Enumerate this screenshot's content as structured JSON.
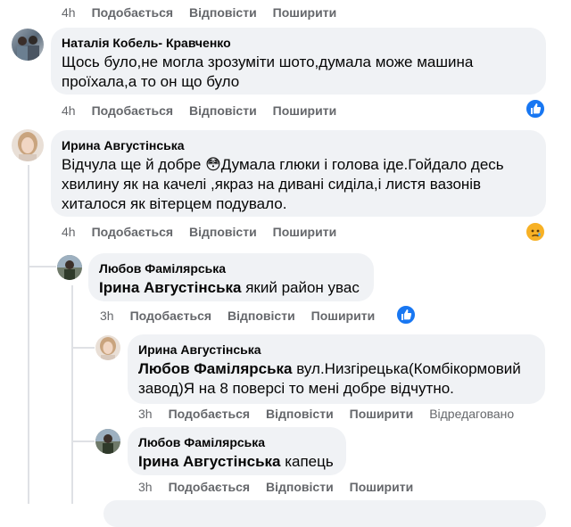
{
  "top_actions": {
    "time": "4h",
    "like": "Подобається",
    "reply": "Відповісти",
    "share": "Поширити"
  },
  "comments": [
    {
      "author": "Наталія Кобель- Кравченко",
      "text": "Щось було,не могла зрозуміти шото,думала може машина проїхала,а то он що було",
      "time": "4h",
      "like": "Подобається",
      "reply": "Відповісти",
      "share": "Поширити",
      "reaction_icon": "like-reaction-icon"
    },
    {
      "author": "Ирина Августінська",
      "text_before_emoji": "Відчула ще й добре ",
      "emoji": "😳",
      "text_after_emoji": "Думала глюки і голова іде.Гойдало десь хвилину як на качелі ,якраз на дивані сиділа,і листя вазонів хиталося як вітерцем подувало.",
      "time": "4h",
      "like": "Подобається",
      "reply": "Відповісти",
      "share": "Поширити",
      "reaction_icon": "sad-reaction-icon"
    }
  ],
  "replies": [
    {
      "author": "Любов Фамілярська",
      "mention": "Ірина Августінська",
      "text": " який район увас",
      "time": "3h",
      "like": "Подобається",
      "reply": "Відповісти",
      "share": "Поширити",
      "reaction_icon": "like-reaction-icon"
    },
    {
      "author": "Ирина Августінська",
      "mention": "Любов Фамілярська",
      "text": " вул.Низгірецька(Комбікормовий завод)Я на 8 поверсі то мені добре відчутно.",
      "time": "3h",
      "like": "Подобається",
      "reply": "Відповісти",
      "share": "Поширити",
      "edited": "Відредаговано"
    },
    {
      "author": "Любов Фамілярська",
      "mention": "Ірина Августінська",
      "text": " капець",
      "time": "3h",
      "like": "Подобається",
      "reply": "Відповісти",
      "share": "Поширити"
    }
  ],
  "colors": {
    "bubble": "#f0f2f5",
    "meta": "#65676b",
    "like_blue": "#1877f2",
    "sad_yellow": "#f7b125"
  }
}
